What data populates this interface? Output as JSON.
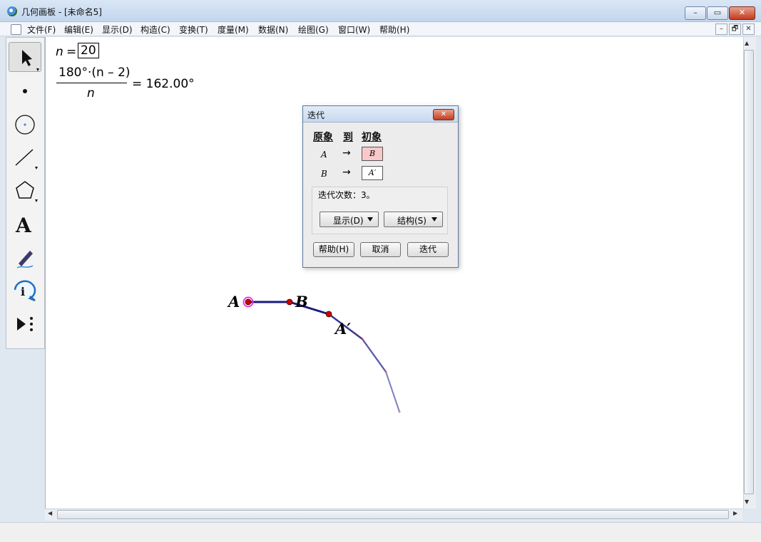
{
  "window": {
    "title": "几何画板 - [未命名5]",
    "min": "–",
    "max": "▭",
    "close": "✕"
  },
  "menu": [
    "文件(F)",
    "编辑(E)",
    "显示(D)",
    "构造(C)",
    "变换(T)",
    "度量(M)",
    "数据(N)",
    "绘图(G)",
    "窗口(W)",
    "帮助(H)"
  ],
  "mdi": {
    "min": "–",
    "restore": "🗗",
    "close": "✕"
  },
  "tools": [
    "select-arrow",
    "point",
    "compass",
    "straightedge",
    "polygon",
    "text",
    "marker",
    "information",
    "custom-tools"
  ],
  "canvas": {
    "param_label": "n",
    "param_eq": "=",
    "param_value": "20",
    "formula_numerator": "180°·(n – 2)",
    "formula_denominator": "n",
    "formula_result": "= 162.00°",
    "label_A": "A",
    "label_B": "B",
    "label_A_prime": "A′"
  },
  "dialog": {
    "title": "迭代",
    "close": "✕",
    "col_preimage": "原象",
    "col_to": "到",
    "col_image": "初象",
    "rows": [
      {
        "from": "A",
        "arrow": "→",
        "to": "B"
      },
      {
        "from": "B",
        "arrow": "→",
        "to": "A′"
      }
    ],
    "iteration_count": "迭代次数：3。",
    "display_btn": "显示(D)",
    "structure_btn": "结构(S)",
    "help_btn": "帮助(H)",
    "cancel_btn": "取消",
    "iterate_btn": "迭代"
  },
  "colors": {
    "segment": "#1a1a80",
    "point": "#cc0000",
    "selected_ring": "#e040e0",
    "mapbox_highlight": "#f7c9c9"
  }
}
